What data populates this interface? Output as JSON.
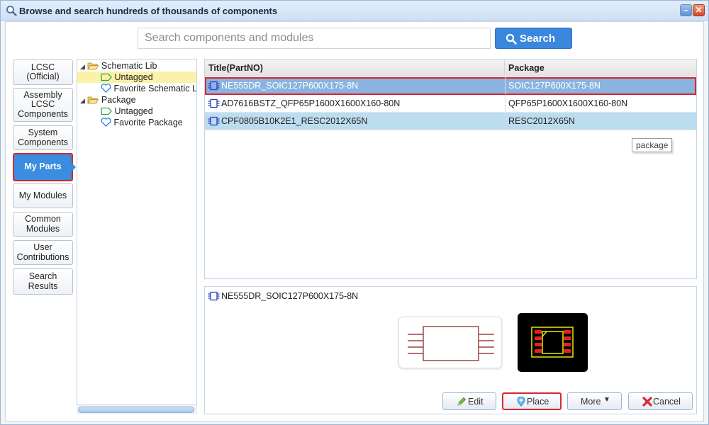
{
  "window": {
    "title": "Browse and search hundreds of thousands of components"
  },
  "search": {
    "placeholder": "Search components and modules",
    "value": "",
    "button_label": "Search"
  },
  "categories": [
    {
      "label": "LCSC\n(Official)"
    },
    {
      "label": "Assembly\nLCSC\nComponents"
    },
    {
      "label": "System\nComponents"
    },
    {
      "label": "My Parts",
      "active": true
    },
    {
      "label": "My Modules"
    },
    {
      "label": "Common\nModules"
    },
    {
      "label": "User\nContributions"
    },
    {
      "label": "Search\nResults"
    }
  ],
  "tree": {
    "schematic_lib": "Schematic Lib",
    "schematic_untagged": "Untagged",
    "schematic_favorite": "Favorite Schematic Lib",
    "package": "Package",
    "package_untagged": "Untagged",
    "package_favorite": "Favorite Package"
  },
  "table": {
    "headers": {
      "title": "Title(PartNO)",
      "package": "Package"
    },
    "rows": [
      {
        "title": "NE555DR_SOIC127P600X175-8N",
        "package": "SOIC127P600X175-8N"
      },
      {
        "title": "AD7616BSTZ_QFP65P1600X1600X160-80N",
        "package": "QFP65P1600X1600X160-80N"
      },
      {
        "title": "CPF0805B10K2E1_RESC2012X65N",
        "package": "RESC2012X65N"
      }
    ],
    "tooltip": "package"
  },
  "preview": {
    "title": "NE555DR_SOIC127P600X175-8N"
  },
  "actions": {
    "edit": "Edit",
    "place": "Place",
    "more": "More",
    "cancel": "Cancel"
  },
  "colors": {
    "accent": "#3b8de0",
    "highlight": "#d9272e",
    "selected_row": "#8bb3e0",
    "alt_row": "#bcdcf0"
  }
}
